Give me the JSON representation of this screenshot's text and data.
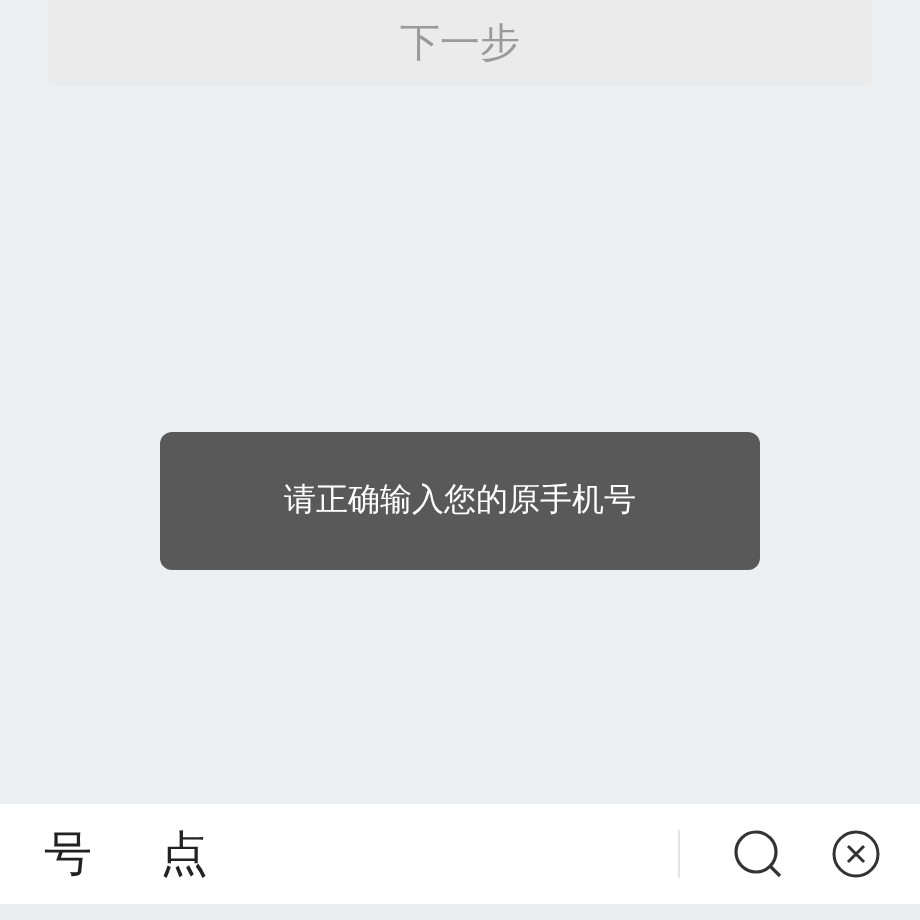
{
  "next_button": {
    "label": "下一步"
  },
  "toast": {
    "message": "请正确输入您的原手机号"
  },
  "keyboard_candidates": [
    {
      "text": "号"
    },
    {
      "text": "点"
    }
  ]
}
